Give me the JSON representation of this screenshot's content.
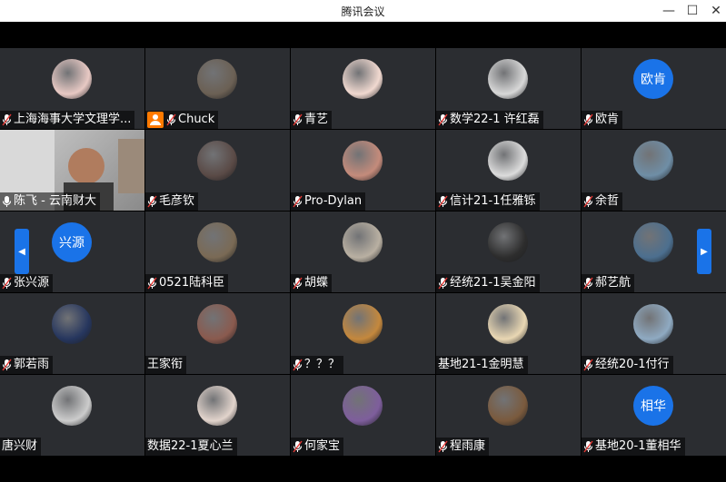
{
  "window": {
    "title": "腾讯会议"
  },
  "participants": [
    {
      "name": "上海海事大学文理学...",
      "avatar": "image",
      "color": "#e8c9c4"
    },
    {
      "name": "Chuck",
      "avatar": "image",
      "color": "#6b6054",
      "host": true
    },
    {
      "name": "青艺",
      "avatar": "image",
      "color": "#f1d9d0"
    },
    {
      "name": "数学22-1 许红磊",
      "avatar": "image",
      "color": "#d8d8d8"
    },
    {
      "name": "欧肯",
      "avatar": "text",
      "text": "欧肯"
    },
    {
      "name": "陈飞 - 云南财大",
      "avatar": "video",
      "speaking": true
    },
    {
      "name": "毛彦钦",
      "avatar": "image",
      "color": "#5a4a46"
    },
    {
      "name": "Pro-Dylan",
      "avatar": "image",
      "color": "#c48b7b"
    },
    {
      "name": "信计21-1任雅铄",
      "avatar": "image",
      "color": "#dcdcdc"
    },
    {
      "name": "余哲",
      "avatar": "image",
      "color": "#6f8ea6"
    },
    {
      "name": "张兴源",
      "avatar": "text",
      "text": "兴源"
    },
    {
      "name": "0521陆科臣",
      "avatar": "image",
      "color": "#7a6a55"
    },
    {
      "name": "胡蝶",
      "avatar": "image",
      "color": "#b9b0a2"
    },
    {
      "name": "经统21-1吴金阳",
      "avatar": "image",
      "color": "#2d2d2d"
    },
    {
      "name": "郝艺航",
      "avatar": "image",
      "color": "#4c6f8f"
    },
    {
      "name": "郭若雨",
      "avatar": "image",
      "color": "#26365e"
    },
    {
      "name": "王家衔",
      "avatar": "image",
      "color": "#8a5a4e",
      "noMic": true
    },
    {
      "name": "？？？",
      "avatar": "image",
      "color": "#c4883d"
    },
    {
      "name": "基地21-1金明慧",
      "avatar": "image",
      "color": "#e9d7b3",
      "noMic": true
    },
    {
      "name": "经统20-1付行",
      "avatar": "image",
      "color": "#8faac2"
    },
    {
      "name": "唐兴财",
      "avatar": "image",
      "color": "#cccccc",
      "noMic": true
    },
    {
      "name": "数据22-1夏心兰",
      "avatar": "image",
      "color": "#e2d4cc",
      "noMic": true
    },
    {
      "name": "何家宝",
      "avatar": "image",
      "color": "#7e5e9c"
    },
    {
      "name": "程雨康",
      "avatar": "image",
      "color": "#7a5a3d"
    },
    {
      "name": "基地20-1董相华",
      "avatar": "text",
      "text": "相华"
    }
  ]
}
